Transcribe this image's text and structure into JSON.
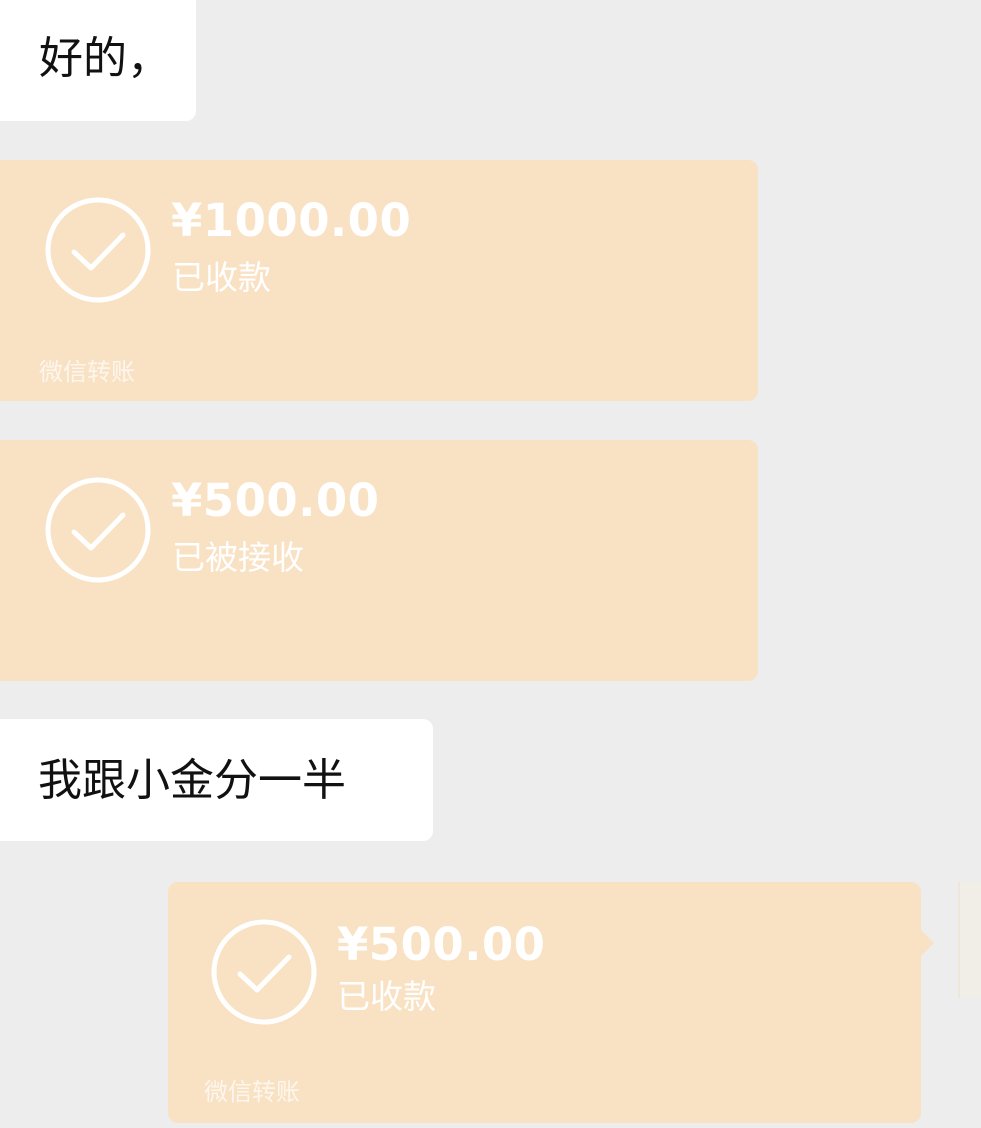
{
  "colors": {
    "background": "#ededed",
    "bubble_text_background": "#ffffff",
    "transfer_card_background": "#f9e1c3",
    "transfer_text": "#ffffff"
  },
  "messages": [
    {
      "type": "text",
      "text": "好的，"
    },
    {
      "type": "transfer",
      "icon": "checkmark-circle-icon",
      "amount": "¥1000.00",
      "status": "已收款",
      "footer": "微信转账"
    },
    {
      "type": "transfer",
      "icon": "checkmark-circle-icon",
      "amount": "¥500.00",
      "status": "已被接收",
      "footer": ""
    },
    {
      "type": "text",
      "text": "我跟小金分一半"
    },
    {
      "type": "transfer",
      "icon": "checkmark-circle-icon",
      "amount": "¥500.00",
      "status": "已收款",
      "footer": "微信转账"
    }
  ]
}
